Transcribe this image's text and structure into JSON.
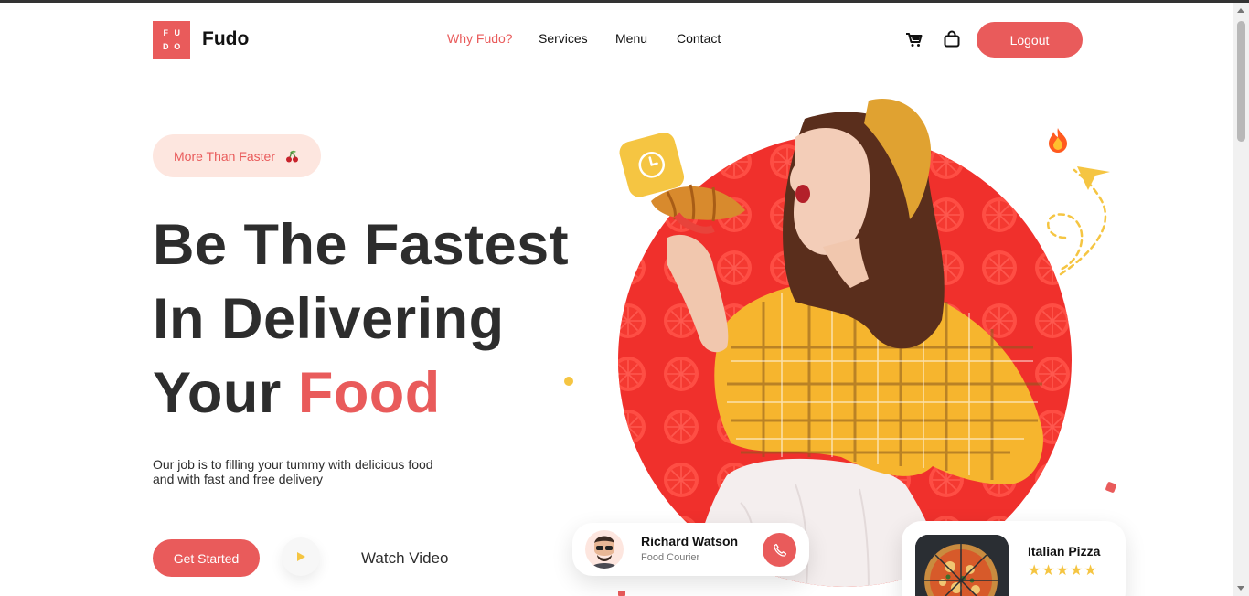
{
  "header": {
    "logo_letters": [
      "F",
      "U",
      "D",
      "O"
    ],
    "brand": "Fudo",
    "nav": [
      {
        "label": "Why Fudo?",
        "active": true
      },
      {
        "label": "Services",
        "active": false
      },
      {
        "label": "Menu",
        "active": false
      },
      {
        "label": "Contact",
        "active": false
      }
    ],
    "icons": [
      "cart-icon",
      "shopping-bag-icon"
    ],
    "logout_label": "Logout"
  },
  "hero": {
    "pill_label": "More Than Faster",
    "pill_icon": "cherry-icon",
    "headline_line1": "Be The Fastest",
    "headline_line2": "In Delivering",
    "headline_line3_prefix": "Your",
    "headline_line3_accent": "Food",
    "subtext": "Our job is to filling your tummy with delicious food and with fast and free delivery",
    "cta_label": "Get Started",
    "watch_label": "Watch Video"
  },
  "courier_card": {
    "name": "Richard Watson",
    "role": "Food Courier"
  },
  "product_card": {
    "name": "Italian Pizza",
    "stars": "★★★★★",
    "rating_value": 5
  },
  "colors": {
    "accent": "#e95b5b",
    "pill_bg": "#fde6df",
    "yellow": "#f5c542",
    "circle": "#f0302c"
  }
}
